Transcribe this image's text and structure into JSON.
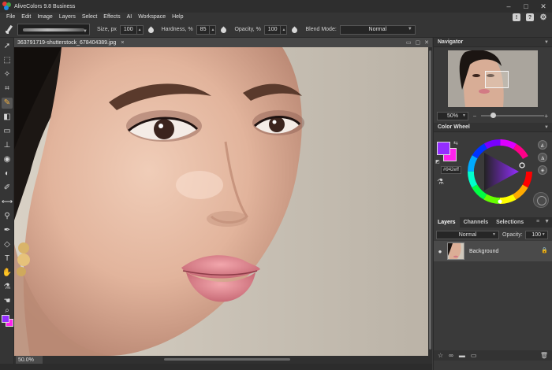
{
  "window": {
    "title": "AliveColors 9.8 Business"
  },
  "menu": {
    "items": [
      "File",
      "Edit",
      "Image",
      "Layers",
      "Select",
      "Effects",
      "AI",
      "Workspace",
      "Help"
    ]
  },
  "options": {
    "size_label": "Size, px",
    "size_value": "100",
    "hardness_label": "Hardness, %",
    "hardness_value": "85",
    "opacity_label": "Opacity, %",
    "opacity_value": "100",
    "blend_label": "Blend Mode:",
    "blend_value": "Normal"
  },
  "document": {
    "tab_name": "363791719-shutterstock_678404389.jpg",
    "close": "×",
    "zoom_status": "50.0%"
  },
  "navigator": {
    "title": "Navigator",
    "zoom_value": "50%"
  },
  "color_wheel": {
    "title": "Color Wheel",
    "hex_value": "#942eff",
    "fg_color": "#942eff",
    "bg_color": "#ff22ee"
  },
  "layers": {
    "tabs": [
      "Layers",
      "Channels",
      "Selections"
    ],
    "blend_value": "Normal",
    "opacity_label": "Opacity:",
    "opacity_value": "100",
    "layer_name": "Background"
  }
}
